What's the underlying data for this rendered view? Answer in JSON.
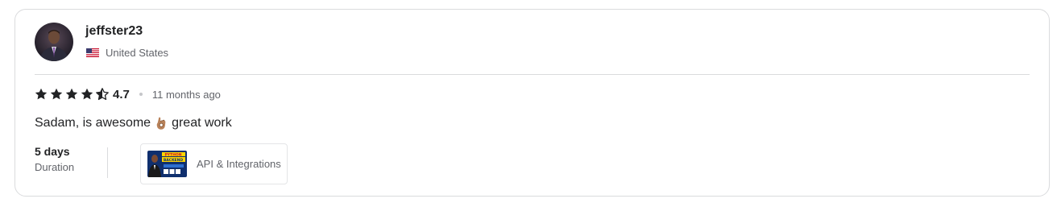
{
  "reviewer": {
    "username": "jeffster23",
    "country": "United States",
    "avatar_icon": "avatar-photo",
    "flag_icon": "us-flag-icon"
  },
  "review": {
    "rating": 4.7,
    "rating_label": "4.7",
    "stars_full": 4,
    "stars_half": 1,
    "time_ago": "11 months ago",
    "text_before": "Sadam, is awesome",
    "text_after": "great work",
    "emoji_icon": "ok-hand-icon"
  },
  "details": {
    "duration_value": "5 days",
    "duration_label": "Duration",
    "gig_label": "API & Integrations",
    "gig_thumb_text": "PYTHON BACKEND"
  },
  "colors": {
    "text_primary": "#222325",
    "text_secondary": "#62646a",
    "border": "#dadbdd",
    "star": "#222325"
  }
}
